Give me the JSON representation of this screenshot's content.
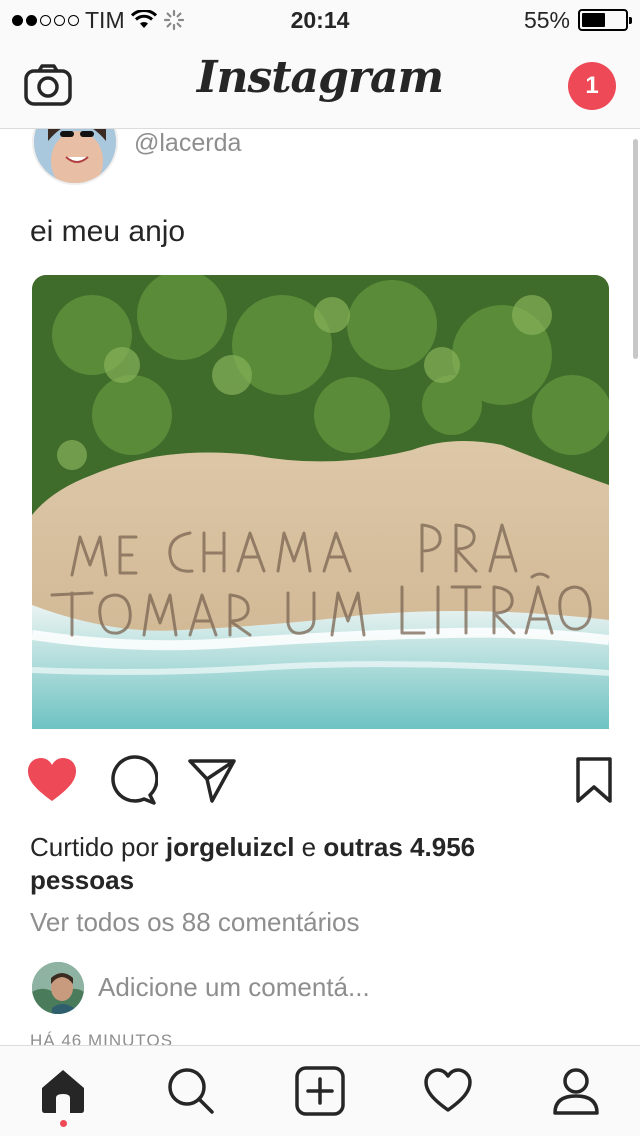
{
  "status_bar": {
    "carrier": "TIM",
    "signal_bars_filled": 2,
    "signal_bars_total": 5,
    "time": "20:14",
    "battery_percent": "55%",
    "battery_level": 0.55
  },
  "header": {
    "brand": "Instagram",
    "notification_count": "1",
    "left_icon": "camera-icon"
  },
  "post": {
    "handle": "@lacerda",
    "text": "ei meu anjo",
    "image_caption_in_photo": "ME CHAMA PRA TOMAR UM LITRÃO",
    "liked": true,
    "likes_prefix": "Curtido por",
    "likes_user": "jorgeluizcl",
    "likes_conj": "e",
    "likes_others": "outras 4.956",
    "likes_suffix": "pessoas",
    "view_comments": "Ver todos os 88 comentários",
    "comment_placeholder": "Adicione um comentá...",
    "timestamp": "HÁ 46 MINUTOS"
  },
  "colors": {
    "like_red": "#ed4956",
    "badge_red": "#ed4956",
    "muted_text": "#8e8e8e",
    "primary_text": "#262626"
  },
  "tab_bar": {
    "tabs": [
      "home-icon",
      "search-icon",
      "add-post-icon",
      "activity-heart-icon",
      "profile-icon"
    ],
    "active": "home-icon"
  }
}
